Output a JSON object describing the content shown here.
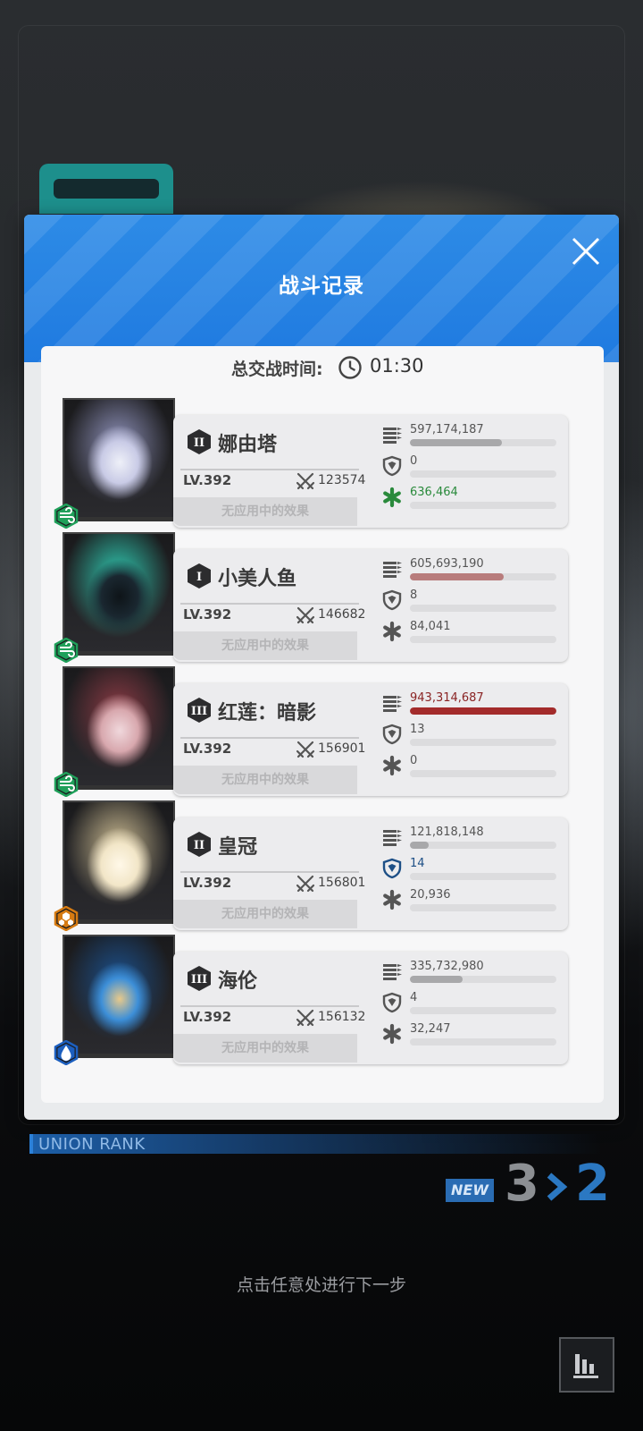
{
  "modal": {
    "title": "战斗记录",
    "timer_label": "总交战时间:",
    "timer_value": "01:30"
  },
  "characters": [
    {
      "name": "娜由塔",
      "burst": "II",
      "level": "LV.392",
      "power": "123574",
      "effects": "无应用中的效果",
      "element": "wind-icon",
      "element_color": "#1fa05a",
      "damage": "597,174,187",
      "damage_fraction": 0.63,
      "damage_color": "#a8a8aa",
      "shield": "0",
      "shield_fraction": 0,
      "shield_color": "#555555",
      "heal": "636,464",
      "heal_fraction": 0,
      "heal_color": "#2a8a3c"
    },
    {
      "name": "小美人鱼",
      "burst": "I",
      "level": "LV.392",
      "power": "146682",
      "effects": "无应用中的效果",
      "element": "wind-icon",
      "element_color": "#1fa05a",
      "damage": "605,693,190",
      "damage_fraction": 0.64,
      "damage_color": "#b87c7c",
      "shield": "8",
      "shield_fraction": 0,
      "shield_color": "#555555",
      "heal": "84,041",
      "heal_fraction": 0,
      "heal_color": "#555555"
    },
    {
      "name": "红莲：暗影",
      "burst": "III",
      "level": "LV.392",
      "power": "156901",
      "effects": "无应用中的效果",
      "element": "wind-icon",
      "element_color": "#1fa05a",
      "damage": "943,314,687",
      "damage_fraction": 1.0,
      "damage_color": "#a32b2b",
      "shield": "13",
      "shield_fraction": 0,
      "shield_color": "#555555",
      "heal": "0",
      "heal_fraction": 0,
      "heal_color": "#555555"
    },
    {
      "name": "皇冠",
      "burst": "II",
      "level": "LV.392",
      "power": "156801",
      "effects": "无应用中的效果",
      "element": "iron-icon",
      "element_color": "#d67b12",
      "damage": "121,818,148",
      "damage_fraction": 0.13,
      "damage_color": "#a8a8aa",
      "shield": "14",
      "shield_fraction": 0,
      "shield_color": "#1d4f86",
      "heal": "20,936",
      "heal_fraction": 0,
      "heal_color": "#555555"
    },
    {
      "name": "海伦",
      "burst": "III",
      "level": "LV.392",
      "power": "156132",
      "effects": "无应用中的效果",
      "element": "water-icon",
      "element_color": "#1c5fbf",
      "damage": "335,732,980",
      "damage_fraction": 0.36,
      "damage_color": "#a8a8aa",
      "shield": "4",
      "shield_fraction": 0,
      "shield_color": "#555555",
      "heal": "32,247",
      "heal_fraction": 0,
      "heal_color": "#555555"
    }
  ],
  "union": {
    "label": "UNION RANK",
    "new_label": "NEW",
    "old_rank": "3",
    "new_rank": "2"
  },
  "hint": "点击任意处进行下一步",
  "colors": {
    "header_blue": "#1f7ae0",
    "accent_blue": "#2b78c2"
  }
}
